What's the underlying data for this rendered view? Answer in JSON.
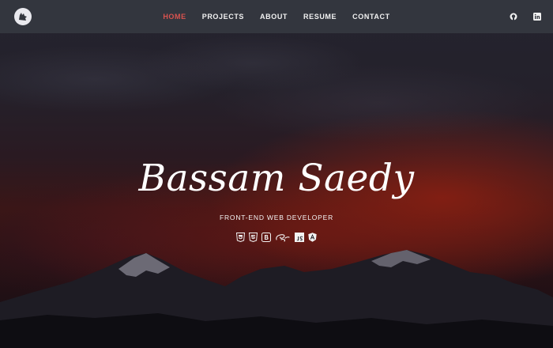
{
  "nav": {
    "links": [
      {
        "label": "HOME"
      },
      {
        "label": "PROJECTS"
      },
      {
        "label": "ABOUT"
      },
      {
        "label": "RESUME"
      },
      {
        "label": "CONTACT"
      }
    ],
    "active_index": 0,
    "active_color": "#d9534f",
    "social_icons": [
      "github-icon",
      "linkedin-icon"
    ],
    "logo_icon": "wolf-logo-icon"
  },
  "hero": {
    "name": "Bassam Saedy",
    "subtitle": "FRONT-END WEB DEVELOPER",
    "tech_icons": [
      "html5-icon",
      "css3-icon",
      "bootstrap-icon",
      "sass-icon",
      "javascript-icon",
      "angular-icon"
    ]
  }
}
